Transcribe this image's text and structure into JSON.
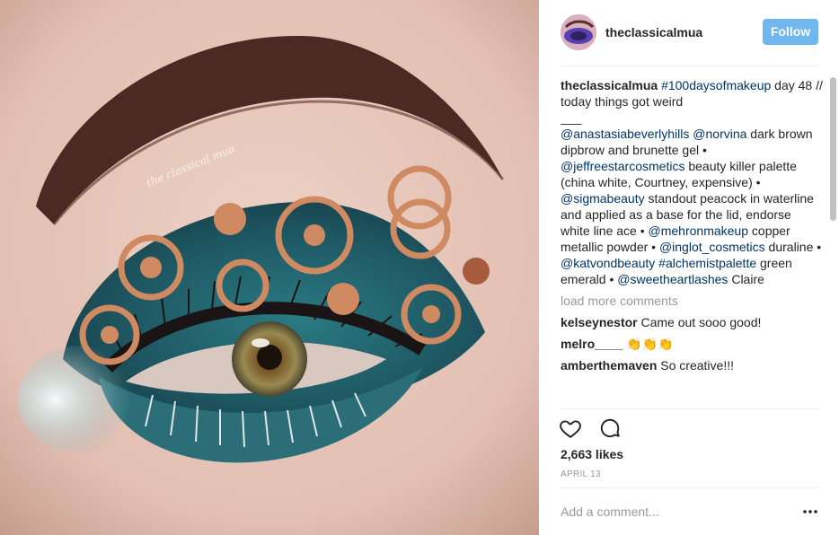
{
  "post": {
    "image_alt": "Eye makeup look with teal eyeshadow and copper circles",
    "watermark": "the classical mua"
  },
  "header": {
    "username": "theclassicalmua",
    "follow_label": "Follow"
  },
  "caption": {
    "username": "theclassicalmua",
    "segments": [
      {
        "text": "#100daysofmakeup",
        "type": "link"
      },
      {
        "text": " day 48 // today things got weird",
        "type": "text"
      },
      {
        "text": "___",
        "type": "break"
      },
      {
        "text": "@anastasiabeverlyhills",
        "type": "link"
      },
      {
        "text": " ",
        "type": "text"
      },
      {
        "text": "@norvina",
        "type": "link"
      },
      {
        "text": " dark brown dipbrow and brunette gel • ",
        "type": "text"
      },
      {
        "text": "@jeffreestarcosmetics",
        "type": "link"
      },
      {
        "text": " beauty killer palette (china white, Courtney, expensive) • ",
        "type": "text"
      },
      {
        "text": "@sigmabeauty",
        "type": "link"
      },
      {
        "text": " standout peacock in waterline and applied as a base for the lid, endorse white line ace • ",
        "type": "text"
      },
      {
        "text": "@mehronmakeup",
        "type": "link"
      },
      {
        "text": " copper metallic powder • ",
        "type": "text"
      },
      {
        "text": "@inglot_cosmetics",
        "type": "link"
      },
      {
        "text": " duraline • ",
        "type": "text"
      },
      {
        "text": "@katvondbeauty",
        "type": "link"
      },
      {
        "text": " ",
        "type": "text"
      },
      {
        "text": "#alchemistpalette",
        "type": "link"
      },
      {
        "text": " green emerald • ",
        "type": "text"
      },
      {
        "text": "@sweetheartlashes",
        "type": "link"
      },
      {
        "text": " Claire",
        "type": "text"
      }
    ]
  },
  "load_more": "load more comments",
  "comments": [
    {
      "username": "kelseynestor",
      "text": "Came out sooo good!"
    },
    {
      "username": "melro____",
      "text": "👏👏👏"
    },
    {
      "username": "amberthemaven",
      "text": "So creative!!!"
    }
  ],
  "actions": {
    "like_icon": "heart-icon",
    "comment_icon": "speech-bubble-icon"
  },
  "likes": "2,663 likes",
  "date": "APRIL 13",
  "add_comment": {
    "placeholder": "Add a comment...",
    "more_icon": "ellipsis-icon"
  },
  "colors": {
    "follow_bg": "#70b7f0",
    "link": "#003569",
    "muted": "#999999",
    "eyeshadow": "#1f5f6a",
    "copper": "#d08a62"
  }
}
